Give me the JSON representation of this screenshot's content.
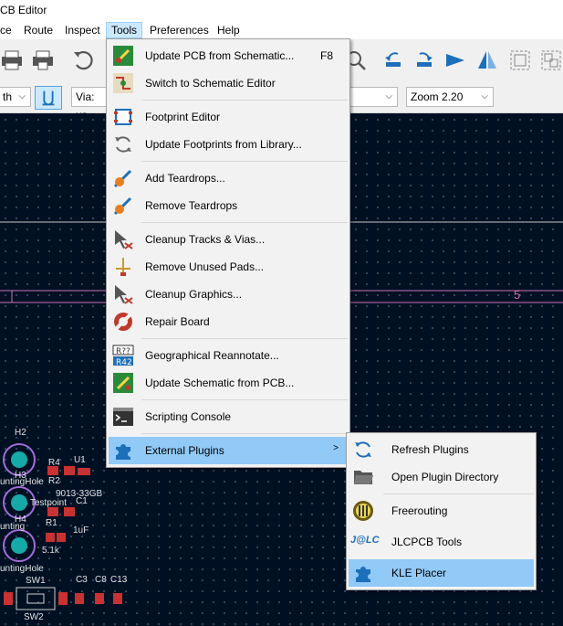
{
  "window": {
    "title": "CB Editor"
  },
  "menubar": {
    "items": [
      "ce",
      "Route",
      "Inspect",
      "Tools",
      "Preferences",
      "Help"
    ]
  },
  "toolbar": {
    "track_width": "th",
    "via_size": "Via: us",
    "zoom": "Zoom 2.20"
  },
  "tools_menu": {
    "items": [
      {
        "label": "Update PCB from Schematic...",
        "shortcut": "F8",
        "icon": "update-pcb-icon"
      },
      {
        "label": "Switch to Schematic Editor",
        "icon": "schematic-editor-icon"
      },
      {
        "label": "Footprint Editor",
        "icon": "footprint-editor-icon"
      },
      {
        "label": "Update Footprints from Library...",
        "icon": "refresh-icon"
      },
      {
        "label": "Add Teardrops...",
        "icon": "teardrop-icon"
      },
      {
        "label": "Remove Teardrops",
        "icon": "teardrop-icon"
      },
      {
        "label": "Cleanup Tracks & Vias...",
        "icon": "cleanup-icon"
      },
      {
        "label": "Remove Unused Pads...",
        "icon": "unused-pads-icon"
      },
      {
        "label": "Cleanup Graphics...",
        "icon": "cleanup-graphics-icon"
      },
      {
        "label": "Repair Board",
        "icon": "repair-icon"
      },
      {
        "label": "Geographical Reannotate...",
        "icon": "reannotate-icon"
      },
      {
        "label": "Update Schematic from PCB...",
        "icon": "update-schematic-icon"
      },
      {
        "label": "Scripting Console",
        "icon": "console-icon"
      },
      {
        "label": "External Plugins",
        "icon": "plugin-icon"
      }
    ]
  },
  "plugins_menu": {
    "items": [
      {
        "label": "Refresh Plugins",
        "icon": "refresh-icon"
      },
      {
        "label": "Open Plugin Directory",
        "icon": "folder-icon"
      },
      {
        "label": "Freerouting",
        "icon": "freerouting-icon"
      },
      {
        "label": "JLCPCB Tools",
        "icon": "jlc-icon",
        "icon_text": "J@LC"
      },
      {
        "label": "KLE Placer",
        "icon": "plugin-icon"
      }
    ]
  },
  "canvas": {
    "layer_number": "5",
    "labels": [
      "H2",
      "H3",
      "H4",
      "R4",
      "U1",
      "R2",
      "R1",
      "C1",
      "SW1",
      "C3",
      "C8",
      "C13",
      "5.1k",
      "1uF",
      "Testpoint",
      "untingHole",
      "9013-33GB",
      "unting",
      "untingHole"
    ],
    "ref_texts": [
      "SW2"
    ]
  },
  "colors": {
    "canvas_bg": "#001023",
    "highlight": "#91c9f7",
    "accent": "#cce8ff"
  }
}
